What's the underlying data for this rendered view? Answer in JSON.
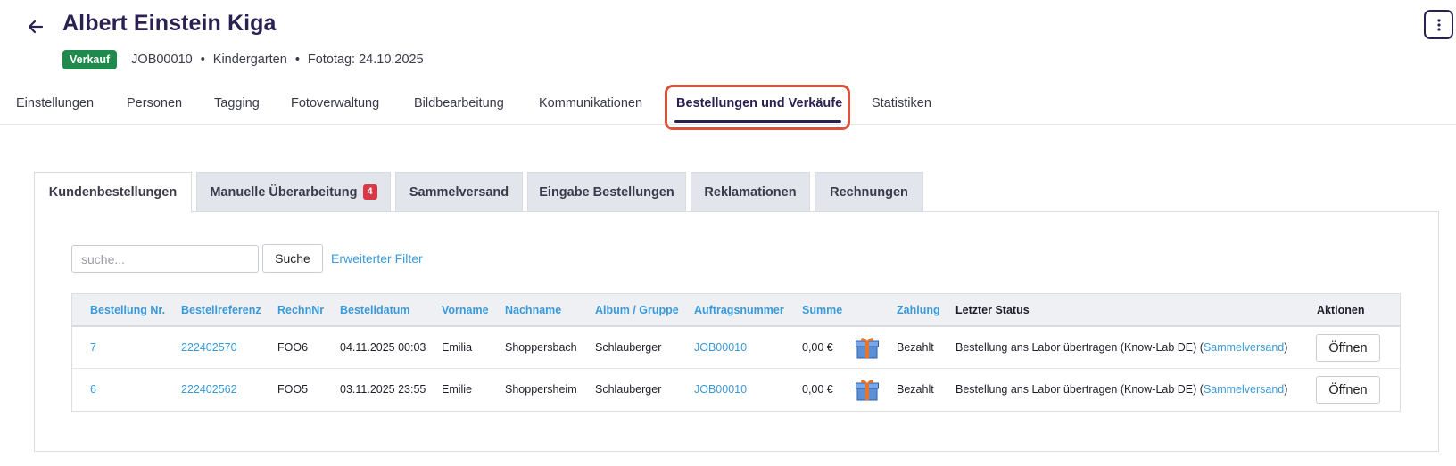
{
  "header": {
    "title": "Albert Einstein Kiga",
    "badge": "Verkauf",
    "job_id": "JOB00010",
    "category": "Kindergarten",
    "photo_day": "Fototag: 24.10.2025",
    "separator": "•"
  },
  "nav": {
    "items": [
      {
        "label": "Einstellungen"
      },
      {
        "label": "Personen"
      },
      {
        "label": "Tagging"
      },
      {
        "label": "Fotoverwaltung"
      },
      {
        "label": "Bildbearbeitung"
      },
      {
        "label": "Kommunikationen"
      },
      {
        "label": "Bestellungen und Verkäufe"
      },
      {
        "label": "Statistiken"
      }
    ],
    "active_index": 6
  },
  "subtabs": {
    "items": [
      {
        "label": "Kundenbestellungen"
      },
      {
        "label": "Manuelle Überarbeitung",
        "count": "4"
      },
      {
        "label": "Sammelversand"
      },
      {
        "label": "Eingabe Bestellungen"
      },
      {
        "label": "Reklamationen"
      },
      {
        "label": "Rechnungen"
      }
    ],
    "active_index": 0
  },
  "search": {
    "placeholder": "suche...",
    "button": "Suche",
    "advanced_filter": "Erweiterter Filter"
  },
  "table": {
    "columns": [
      "Bestellung Nr.",
      "Bestellreferenz",
      "RechnNr",
      "Bestelldatum",
      "Vorname",
      "Nachname",
      "Album / Gruppe",
      "Auftragsnummer",
      "Summe",
      "Zahlung",
      "Letzter Status",
      "Aktionen"
    ],
    "rows": [
      {
        "nr": "7",
        "ref": "222402570",
        "rechnr": "FOO6",
        "date": "04.11.2025 00:03",
        "vorname": "Emilia",
        "nachname": "Shoppersbach",
        "album": "Schlauberger",
        "auftrag": "JOB00010",
        "summe": "0,00 €",
        "icon": "gift-icon",
        "zahlung": "Bezahlt",
        "status_text": "Bestellung ans Labor übertragen (Know-Lab DE) (",
        "status_link": "Sammelversand",
        "status_close": ")",
        "action": "Öffnen"
      },
      {
        "nr": "6",
        "ref": "222402562",
        "rechnr": "FOO5",
        "date": "03.11.2025 23:55",
        "vorname": "Emilie",
        "nachname": "Shoppersheim",
        "album": "Schlauberger",
        "auftrag": "JOB00010",
        "summe": "0,00 €",
        "icon": "gift-icon",
        "zahlung": "Bezahlt",
        "status_text": "Bestellung ans Labor übertragen (Know-Lab DE) (",
        "status_link": "Sammelversand",
        "status_close": ")",
        "action": "Öffnen"
      }
    ]
  },
  "colors": {
    "primary_dark": "#2a2150",
    "link": "#3a9ad9",
    "badge_green": "#1f8a4c",
    "count_red": "#d93846",
    "highlight": "#d9533a"
  }
}
